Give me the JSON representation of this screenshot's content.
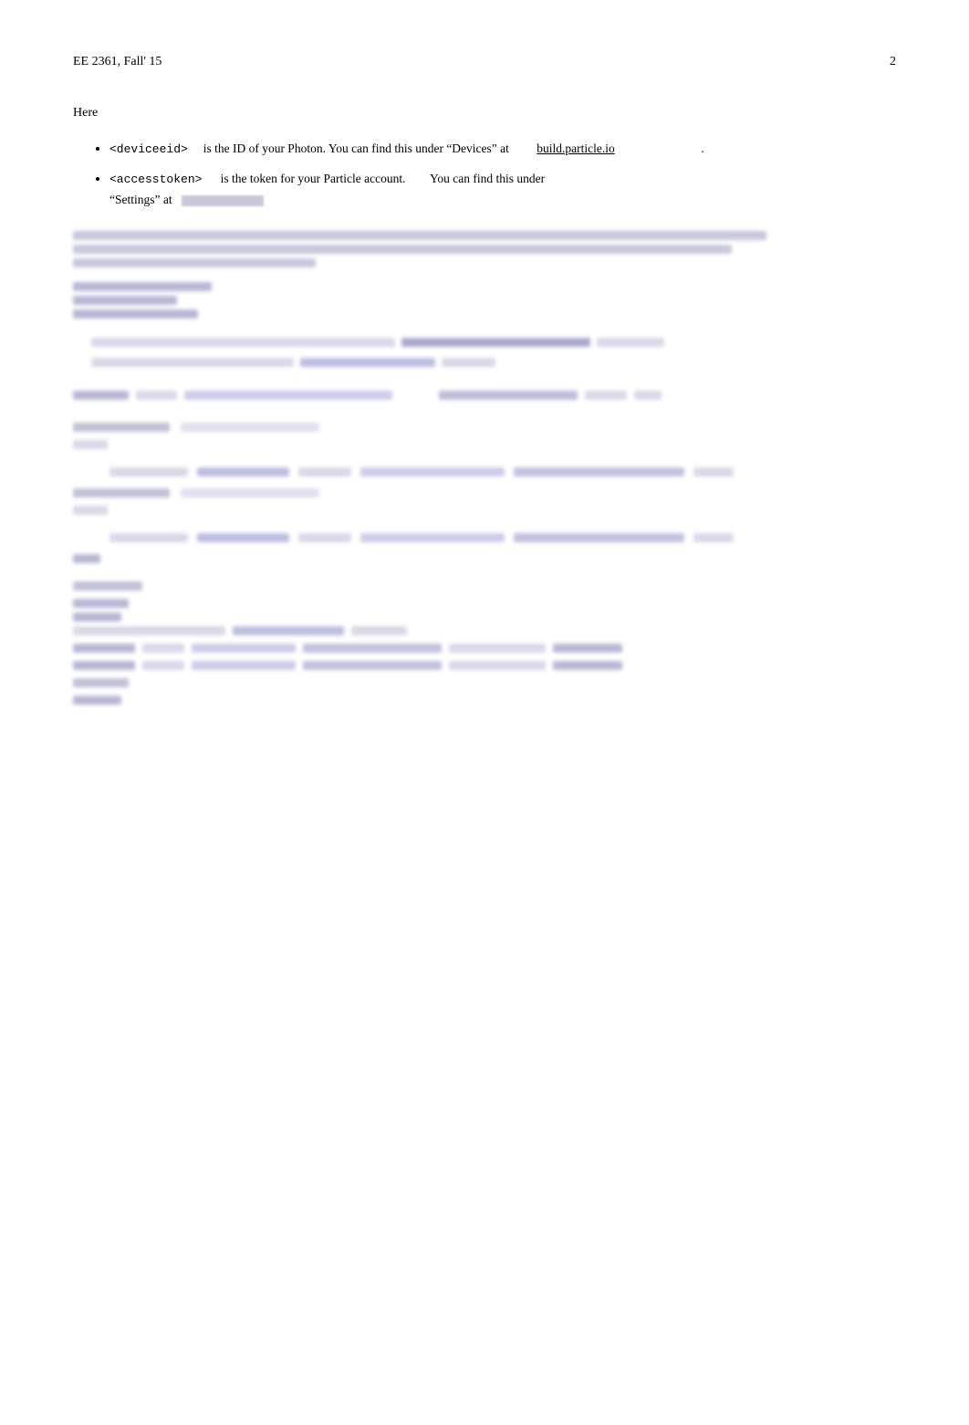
{
  "header": {
    "left": "EE 2361, Fall' 15",
    "right": "2"
  },
  "section_here": "Here",
  "bullets": [
    {
      "id": "deviceid",
      "tag": "<deviceid>",
      "description": "is the ID of your Photon. You can find this under “Devices” at",
      "link": "build.particle.io",
      "suffix": "."
    },
    {
      "id": "accesstoken",
      "tag": "<accesstoken>",
      "description": "is the token for your Particle account.",
      "suffix_text": "You can find this under “Settings” at",
      "link": ""
    }
  ],
  "blurred_intro": {
    "lines": [
      3,
      2,
      1
    ],
    "widths": [
      "100%",
      "95%",
      "40%"
    ]
  },
  "code_section": {
    "vars": [
      "token",
      "device",
      "filter"
    ],
    "indent_lines": 2,
    "comment_blocks": 2
  },
  "find_this_under": "You find this   under"
}
